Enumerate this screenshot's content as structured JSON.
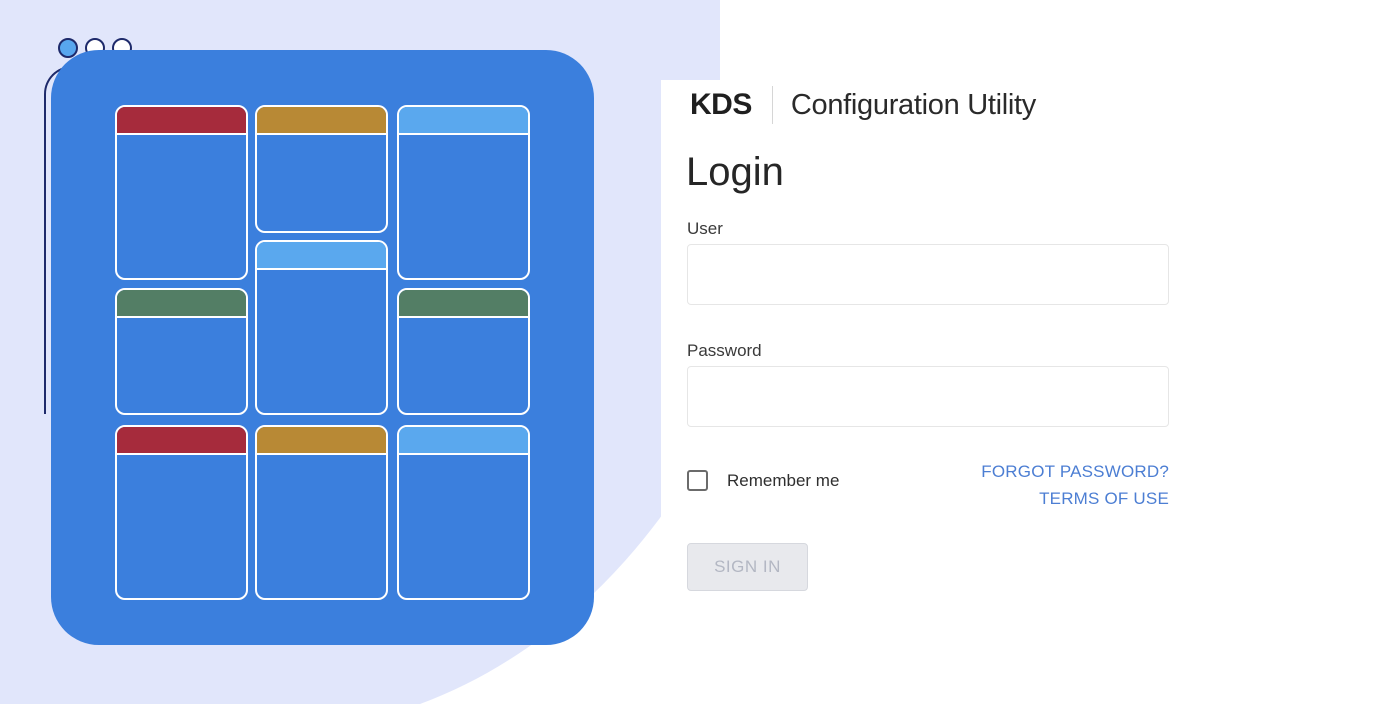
{
  "brand": {
    "logo": "KDS",
    "subtitle": "Configuration Utility"
  },
  "login": {
    "title": "Login",
    "user_label": "User",
    "user_value": "",
    "password_label": "Password",
    "password_value": "",
    "remember_label": "Remember me",
    "remember_checked": false,
    "forgot_link": "FORGOT PASSWORD?",
    "terms_link": "TERMS OF USE",
    "signin_label": "SIGN IN"
  },
  "colors": {
    "accent": "#3b7fdd",
    "link": "#4c7ed3",
    "background_shape": "#e1e6fb",
    "tile_red": "#a62b3c",
    "tile_gold": "#b88935",
    "tile_sky": "#5aa8ee",
    "tile_green": "#537e65"
  },
  "icons": {
    "window_dots": [
      "window-dot-icon",
      "window-dot-icon",
      "window-dot-icon"
    ],
    "remember": "checkbox-icon"
  }
}
